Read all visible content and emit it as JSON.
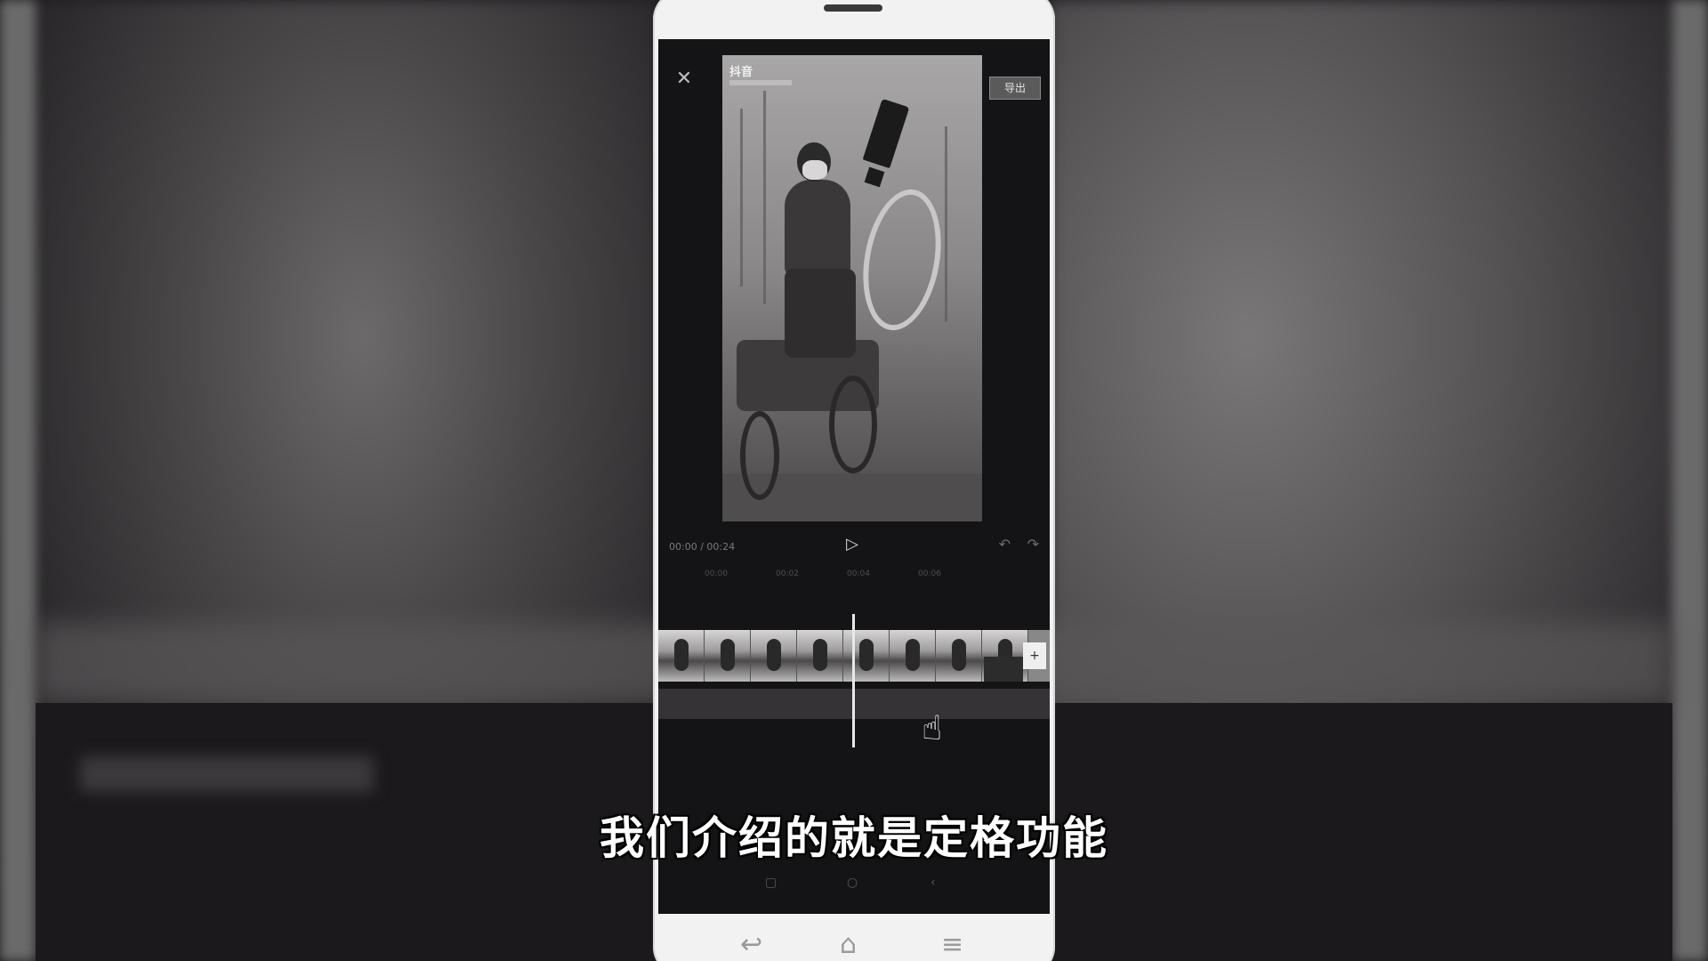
{
  "editor": {
    "close_icon": "✕",
    "export_label": "导出",
    "watermark": "抖音",
    "timecode": "00:00 / 00:24",
    "play_icon": "▷",
    "undo_icon": "↶",
    "redo_icon": "↷",
    "ticks": [
      "00:00",
      "00:02",
      "00:04",
      "00:06"
    ],
    "add_clip_icon": "+"
  },
  "subtitle": "我们介绍的就是定格功能",
  "inner_nav": {
    "square": "▢",
    "circle": "○",
    "back": "‹"
  },
  "hardware": {
    "back": "↩",
    "home": "⌂",
    "menu": "≡"
  },
  "colors": {
    "background": "#1f1d20",
    "phone_body": "#f2f2f2",
    "screen": "#141315",
    "subtitle": "#ffffff"
  }
}
